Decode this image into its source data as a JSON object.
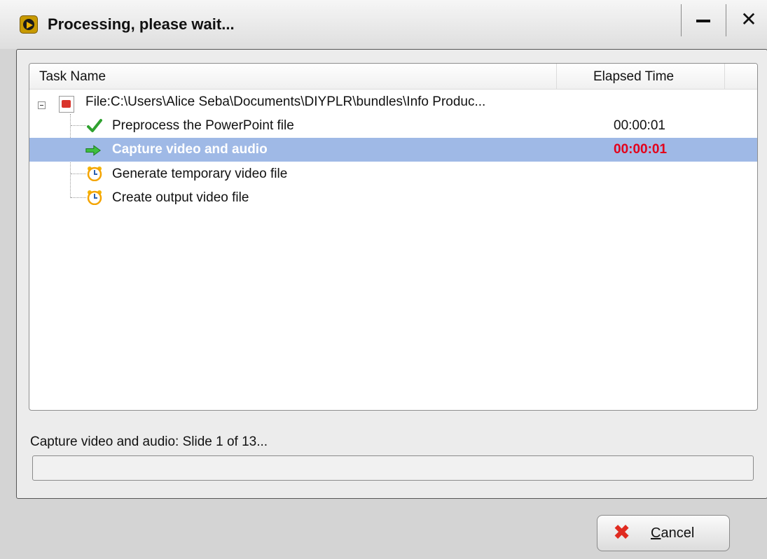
{
  "window": {
    "title": "Processing, please wait...",
    "minimize_glyph": "—",
    "close_glyph": "✕"
  },
  "tree": {
    "columns": {
      "task": "Task Name",
      "elapsed": "Elapsed Time"
    },
    "file_node": {
      "label": "File:C:\\Users\\Alice Seba\\Documents\\DIYPLR\\bundles\\Info Produc...",
      "icon": "powerpoint-file-icon"
    },
    "tasks": [
      {
        "label": "Preprocess the PowerPoint file",
        "time": "00:00:01",
        "icon": "checkmark-icon",
        "state": "done"
      },
      {
        "label": "Capture video and audio",
        "time": "00:00:01",
        "icon": "arrow-right-icon",
        "state": "running"
      },
      {
        "label": "Generate temporary video file",
        "time": "",
        "icon": "alarm-clock-icon",
        "state": "pending"
      },
      {
        "label": "Create output video file",
        "time": "",
        "icon": "alarm-clock-icon",
        "state": "pending"
      }
    ]
  },
  "status": {
    "text": "Capture video and audio: Slide 1 of 13...",
    "progress_fraction": 0.0
  },
  "cancel": {
    "label_underlined": "C",
    "label_rest": "ancel"
  },
  "colors": {
    "selection": "#9fb9e6",
    "running_time": "#e3001b",
    "check_green": "#2fa12f",
    "arrow_green": "#3fbf3f",
    "cancel_red": "#e02b20"
  }
}
